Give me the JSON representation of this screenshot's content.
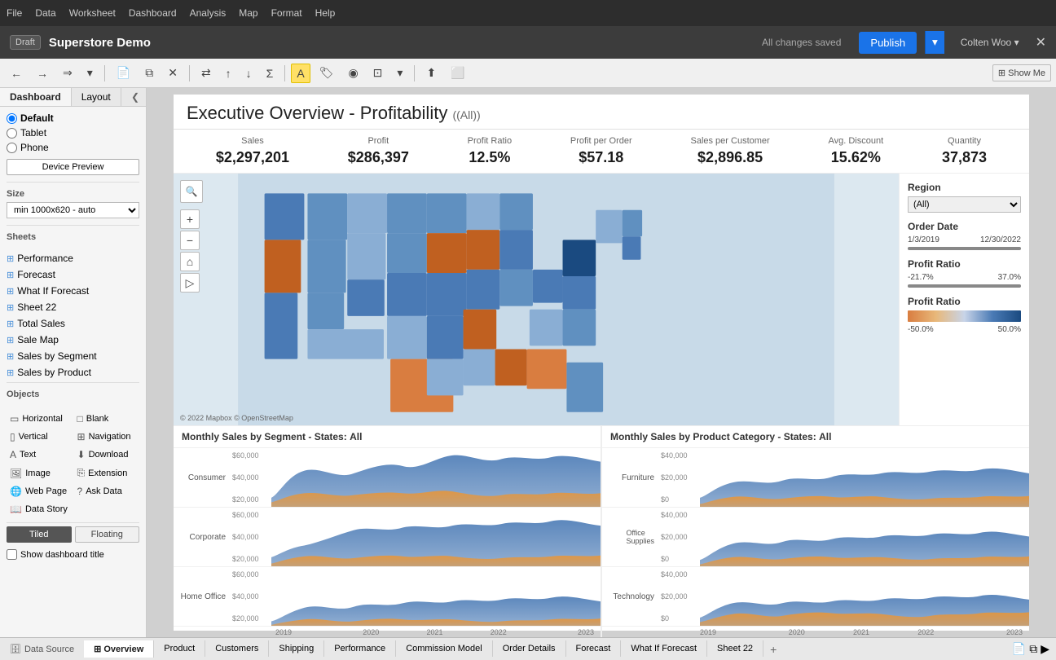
{
  "menubar": {
    "items": [
      "File",
      "Data",
      "Worksheet",
      "Dashboard",
      "Analysis",
      "Map",
      "Format",
      "Help"
    ]
  },
  "titlebar": {
    "draft_label": "Draft",
    "title": "Superstore Demo",
    "save_status": "All changes saved",
    "publish_label": "Publish",
    "user_name": "Colten Woo ▾"
  },
  "left_panel": {
    "tabs": [
      "Dashboard",
      "Layout"
    ],
    "device_label": "Device Preview",
    "devices": [
      "Default",
      "Tablet",
      "Phone"
    ],
    "device_preview_btn": "Device Preview",
    "size_label": "Size",
    "size_value": "min 1000x620 - auto",
    "sheets_label": "Sheets",
    "sheets": [
      "Performance",
      "Forecast",
      "What If Forecast",
      "Sheet 22",
      "Total Sales",
      "Sale Map",
      "Sales by Segment",
      "Sales by Product"
    ],
    "objects_label": "Objects",
    "objects": [
      {
        "icon": "▭",
        "label": "Horizontal"
      },
      {
        "icon": "□",
        "label": "Blank"
      },
      {
        "icon": "▯",
        "label": "Vertical"
      },
      {
        "icon": "⊞",
        "label": "Navigation"
      },
      {
        "icon": "A",
        "label": "Text"
      },
      {
        "icon": "⬇",
        "label": "Download"
      },
      {
        "icon": "🖼",
        "label": "Image"
      },
      {
        "icon": "⎘",
        "label": "Extension"
      },
      {
        "icon": "🌐",
        "label": "Web Page"
      },
      {
        "icon": "?",
        "label": "Ask Data"
      },
      {
        "icon": "📖",
        "label": "Data Story"
      }
    ],
    "tiled_label": "Tiled",
    "floating_label": "Floating",
    "show_title_label": "Show dashboard title"
  },
  "dashboard": {
    "title": "Executive Overview - Profitability",
    "title_filter": "(All)",
    "metrics": [
      {
        "label": "Sales",
        "value": "$2,297,201"
      },
      {
        "label": "Profit",
        "value": "$286,397"
      },
      {
        "label": "Profit Ratio",
        "value": "12.5%"
      },
      {
        "label": "Profit per Order",
        "value": "$57.18"
      },
      {
        "label": "Sales per Customer",
        "value": "$2,896.85"
      },
      {
        "label": "Avg. Discount",
        "value": "15.62%"
      },
      {
        "label": "Quantity",
        "value": "37,873"
      }
    ],
    "filters": {
      "region_label": "Region",
      "region_value": "(All)",
      "order_date_label": "Order Date",
      "date_start": "1/3/2019",
      "date_end": "12/30/2022",
      "profit_ratio_label": "Profit Ratio",
      "profit_min": "-21.7%",
      "profit_max": "37.0%",
      "profit_ratio_label2": "Profit Ratio",
      "color_min": "-50.0%",
      "color_max": "50.0%"
    },
    "segments_title": "Monthly Sales by Segment - States:",
    "segments_filter": "All",
    "product_title": "Monthly Sales by Product Category - States:",
    "product_filter": "All",
    "segments": [
      {
        "label": "Consumer",
        "y_labels": [
          "$60,000",
          "$40,000",
          "$20,000"
        ]
      },
      {
        "label": "Corporate",
        "y_labels": [
          "$60,000",
          "$40,000",
          "$20,000"
        ]
      },
      {
        "label": "Home Office",
        "y_labels": [
          "$60,000",
          "$40,000",
          "$20,000"
        ]
      }
    ],
    "products": [
      {
        "label": "Furniture",
        "y_labels": [
          "$40,000",
          "$20,000",
          "$0"
        ]
      },
      {
        "label": "Office\nSupplies",
        "y_labels": [
          "$40,000",
          "$20,000",
          "$0"
        ]
      },
      {
        "label": "Technology",
        "y_labels": [
          "$40,000",
          "$20,000",
          "$0"
        ]
      }
    ],
    "chart_years": [
      "2019",
      "2020",
      "2021",
      "2022",
      "2023"
    ],
    "map_copyright": "© 2022 Mapbox  © OpenStreetMap"
  },
  "bottom_tabs": {
    "datasource": "Data Source",
    "tabs": [
      {
        "label": "Overview",
        "active": true
      },
      {
        "label": "Product"
      },
      {
        "label": "Customers"
      },
      {
        "label": "Shipping"
      },
      {
        "label": "Performance"
      },
      {
        "label": "Commission Model"
      },
      {
        "label": "Order Details"
      },
      {
        "label": "Forecast"
      },
      {
        "label": "What If Forecast"
      },
      {
        "label": "Sheet 22"
      }
    ]
  }
}
